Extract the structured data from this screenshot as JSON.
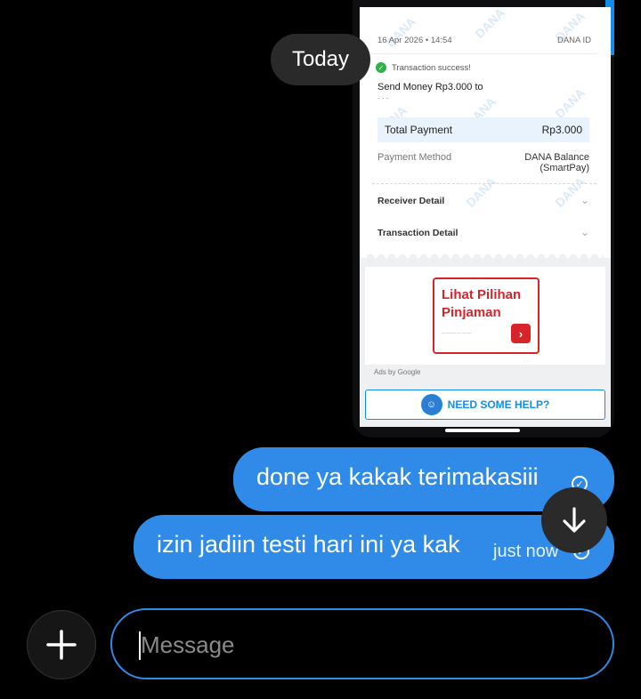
{
  "date_divider": "Today",
  "shared_image": {
    "header_date": "16 Apr 2026 • 14:54",
    "header_id_label": "DANA ID",
    "status": "Transaction success!",
    "send_line": "Send Money Rp3.000 to",
    "total_label": "Total Payment",
    "total_value": "Rp3.000",
    "payment_method_label": "Payment Method",
    "payment_method_value_1": "DANA Balance",
    "payment_method_value_2": "(SmartPay)",
    "receiver_detail": "Receiver Detail",
    "transaction_detail": "Transaction Detail",
    "watermark": "DANA",
    "ad_title_1": "Lihat Pilihan",
    "ad_title_2": "Pinjaman",
    "ads_by": "Ads by Google",
    "help_button": "NEED SOME HELP?"
  },
  "messages": [
    {
      "text": "done ya kakak terimakasiii",
      "time": ""
    },
    {
      "text": "izin jadiin testi hari ini ya kak",
      "time": "just now"
    }
  ],
  "composer": {
    "placeholder": "Message"
  },
  "colors": {
    "bubble": "#2f8be7",
    "dana_blue": "#108ee9",
    "ad_red": "#d8232a",
    "background": "#000000"
  }
}
